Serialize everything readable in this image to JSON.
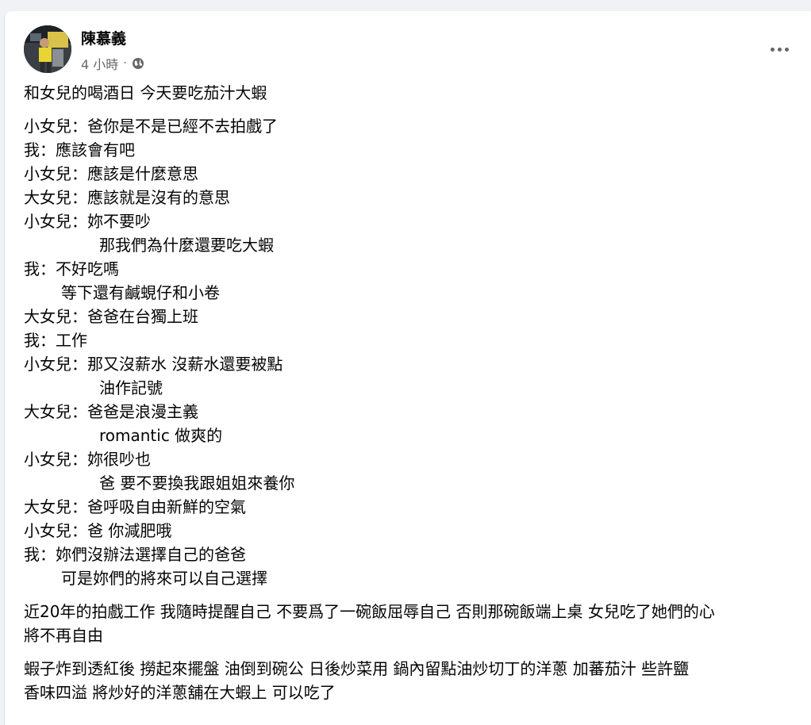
{
  "post": {
    "author": "陳慕義",
    "time": "4 小時",
    "separator": "·",
    "privacy_icon": "globe-icon",
    "more_icon": "more-horizontal-icon"
  },
  "content": {
    "intro": "和女兒的喝酒日 今天要吃茄汁大蝦",
    "dialogue": [
      "小女兒：爸你是不是已經不去拍戲了",
      "我：應該會有吧",
      "小女兒：應該是什麼意思",
      "大女兒：應該就是沒有的意思",
      "小女兒：妳不要吵",
      "那我們為什麼還要吃大蝦",
      "我：不好吃嗎",
      "等下還有鹹蜆仔和小卷",
      "大女兒：爸爸在台獨上班",
      "我：工作",
      "小女兒：那又沒薪水 沒薪水還要被點",
      "油作記號",
      "大女兒：爸爸是浪漫主義",
      "romantic 做爽的",
      "小女兒：妳很吵也",
      "爸 要不要換我跟姐姐來養你",
      "大女兒：爸呼吸自由新鮮的空氣",
      "小女兒：爸 你減肥哦",
      "我：妳們沒辦法選擇自己的爸爸",
      "可是妳們的將來可以自己選擇"
    ],
    "reflection": [
      "近20年的拍戲工作 我隨時提醒自己 不要爲了一碗飯屈辱自己 否則那碗飯端上桌 女兒吃了她們的心",
      "將不再自由"
    ],
    "recipe": [
      "蝦子炸到透紅後 撈起來擺盤 油倒到碗公 日後炒菜用 鍋內留點油炒切丁的洋蔥 加蕃茄汁 些許鹽",
      "香味四溢 將炒好的洋蔥舖在大蝦上 可以吃了"
    ]
  }
}
